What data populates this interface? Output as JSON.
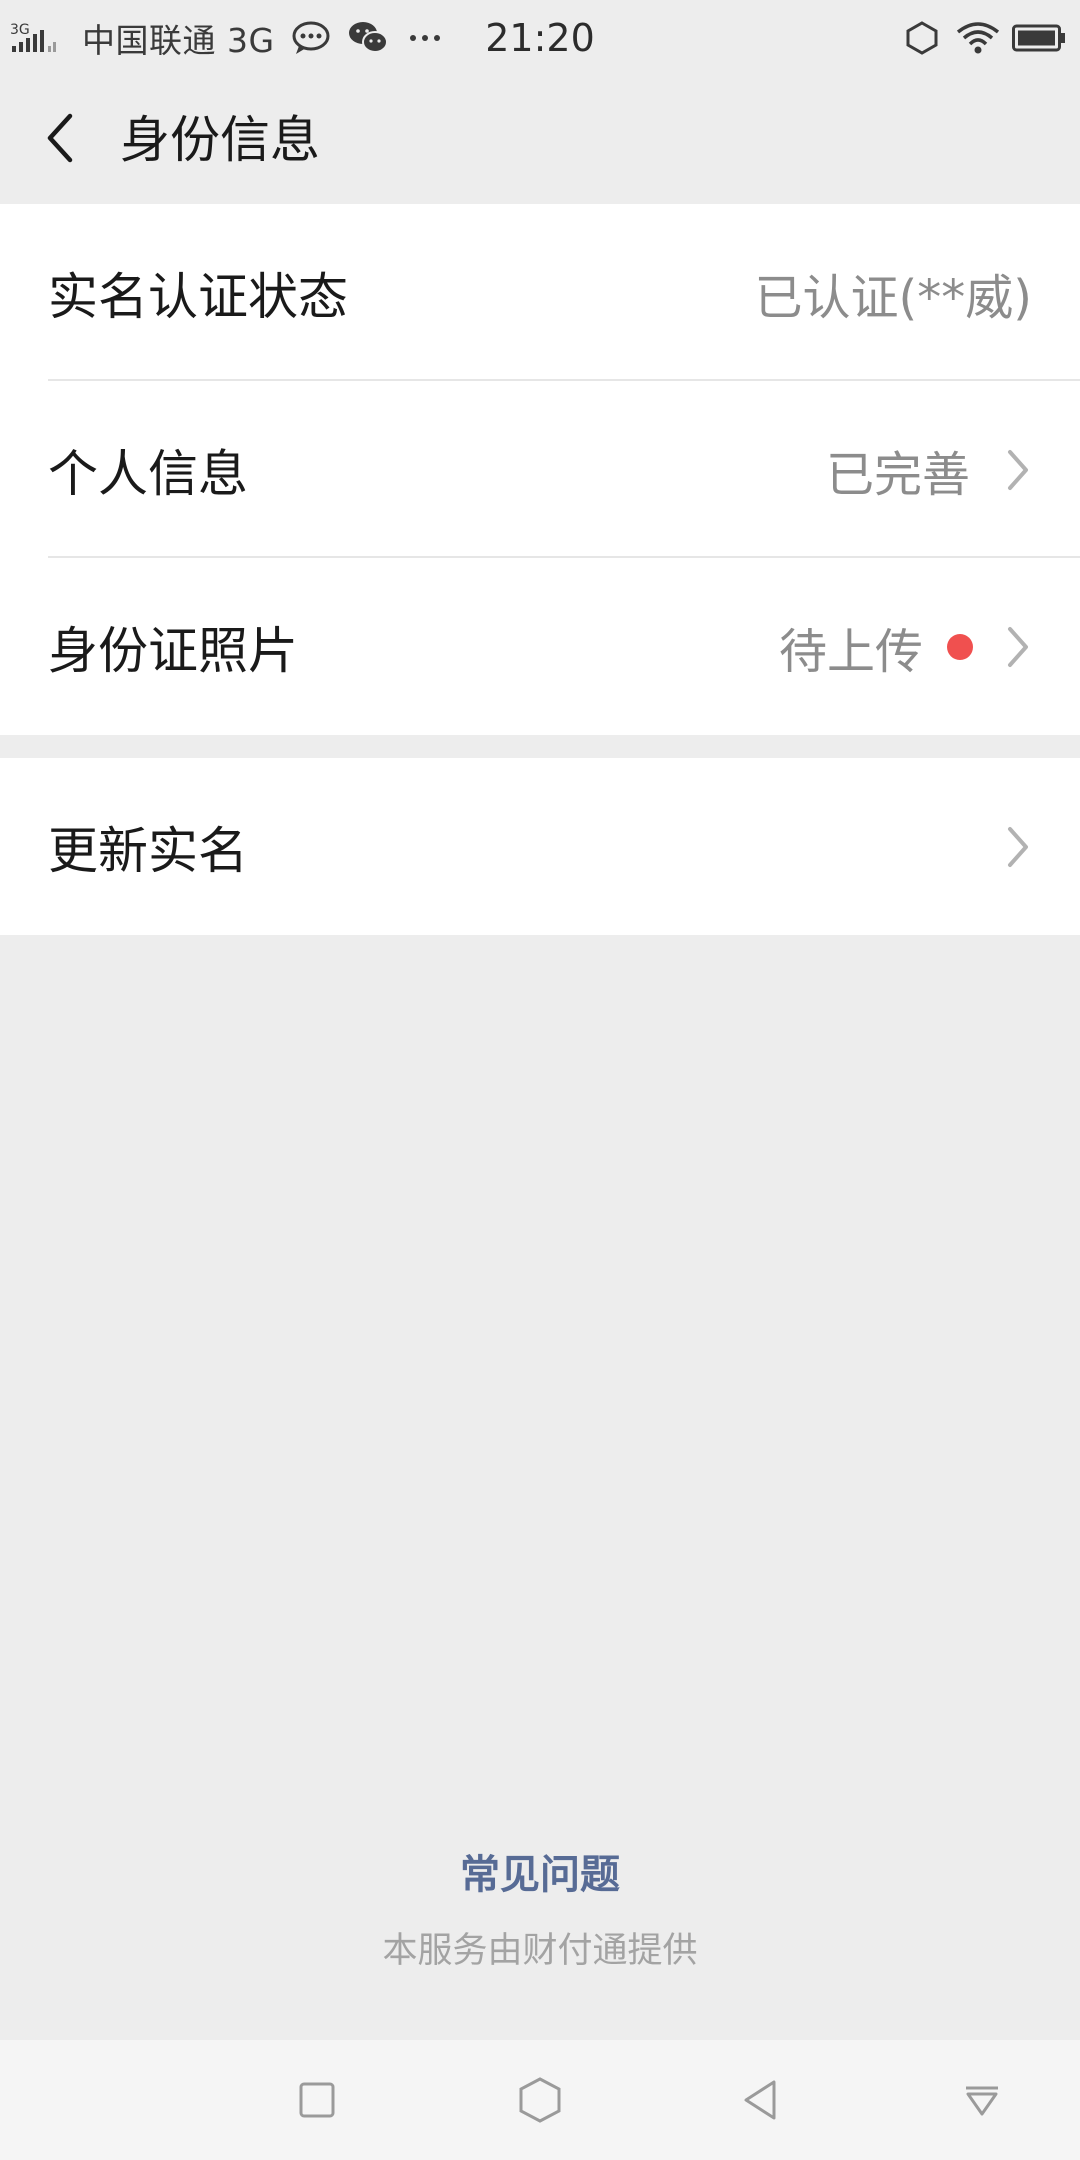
{
  "status_bar": {
    "signal_label": "3G",
    "carrier": "中国联通 3G",
    "time": "21:20",
    "icons": [
      "signal-icon",
      "message-bubble-icon",
      "wechat-icon",
      "more-dots-icon",
      "hexagon-icon",
      "wifi-icon",
      "battery-icon"
    ]
  },
  "header": {
    "title": "身份信息",
    "back_icon": "back-chevron-icon"
  },
  "groups": [
    {
      "cells": [
        {
          "label": "实名认证状态",
          "value": "已认证(**威)",
          "has_chevron": false,
          "has_dot": false
        },
        {
          "label": "个人信息",
          "value": "已完善",
          "has_chevron": true,
          "has_dot": false
        },
        {
          "label": "身份证照片",
          "value": "待上传",
          "has_chevron": true,
          "has_dot": true
        }
      ]
    },
    {
      "cells": [
        {
          "label": "更新实名",
          "value": "",
          "has_chevron": true,
          "has_dot": false
        }
      ]
    }
  ],
  "footer": {
    "faq_link": "常见问题",
    "provider_note": "本服务由财付通提供"
  },
  "system_nav": {
    "buttons": [
      "recent-apps-icon",
      "home-icon",
      "back-icon",
      "notification-pull-icon"
    ]
  },
  "colors": {
    "background": "#ededed",
    "card": "#ffffff",
    "link": "#576b95",
    "red_dot": "#f0504f"
  }
}
